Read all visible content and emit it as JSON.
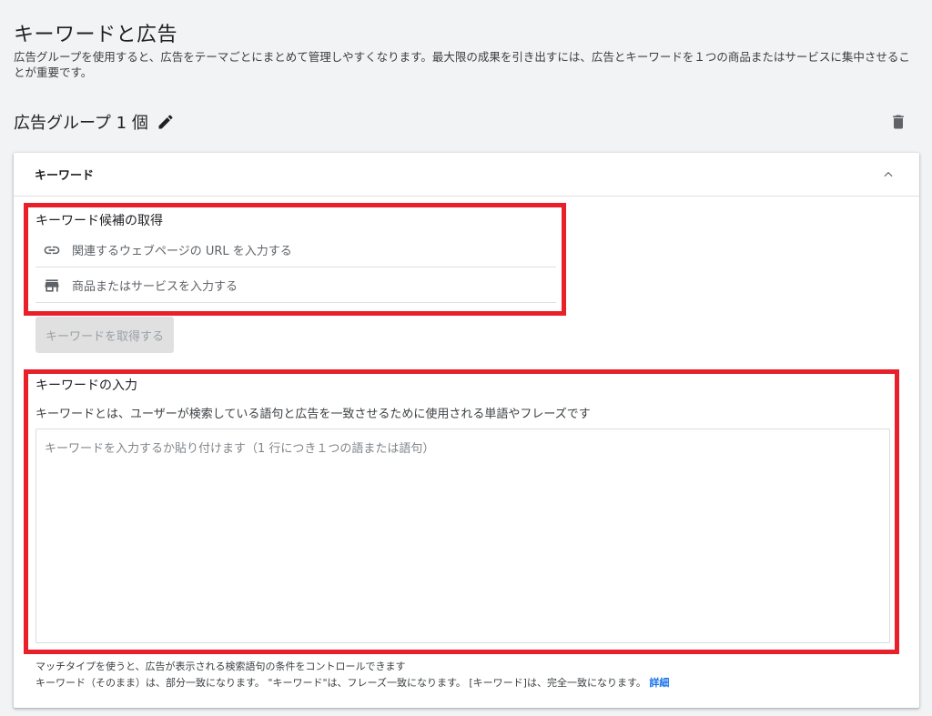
{
  "page": {
    "title": "キーワードと広告",
    "description": "広告グループを使用すると、広告をテーマごとにまとめて管理しやすくなります。最大限の成果を引き出すには、広告とキーワードを１つの商品またはサービスに集中させることが重要です。"
  },
  "ad_group": {
    "title": "広告グループ 1 個"
  },
  "keywords_card": {
    "header": "キーワード",
    "suggestions": {
      "label": "キーワード候補の取得",
      "url_option": "関連するウェブページの URL を入力する",
      "product_option": "商品またはサービスを入力する",
      "get_button": "キーワードを取得する"
    },
    "input": {
      "label": "キーワードの入力",
      "description": "キーワードとは、ユーザーが検索している語句と広告を一致させるために使用される単語やフレーズです",
      "placeholder": "キーワードを入力するか貼り付けます（1 行につき１つの語または語句）"
    },
    "match_note": {
      "line1": "マッチタイプを使うと、広告が表示される検索語句の条件をコントロールできます",
      "line2": "キーワード（そのまま）は、部分一致になります。 \"キーワード\"は、フレーズ一致になります。 [キーワード]は、完全一致になります。",
      "link": "詳細"
    }
  },
  "colors": {
    "highlight": "#e8202a",
    "link": "#1a73e8",
    "background": "#f1f3f4"
  },
  "icons": [
    "edit-icon",
    "delete-icon",
    "collapse-icon",
    "link-icon",
    "store-icon"
  ]
}
